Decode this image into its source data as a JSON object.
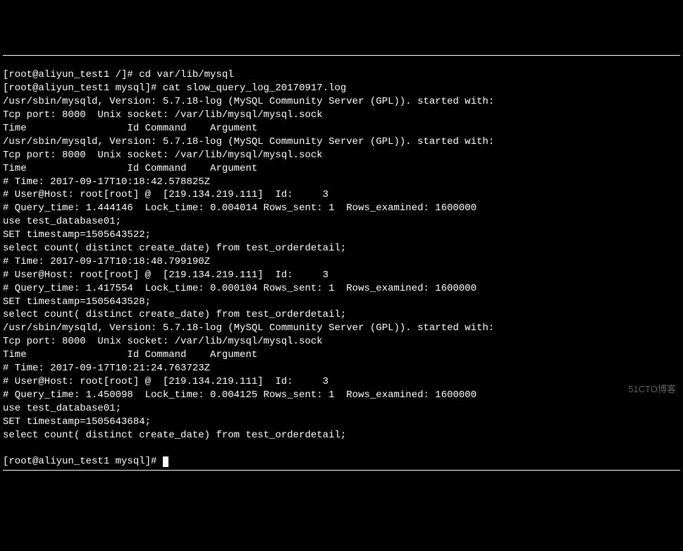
{
  "terminal": {
    "lines": [
      "[root@aliyun_test1 /]# cd var/lib/mysql",
      "[root@aliyun_test1 mysql]# cat slow_query_log_20170917.log",
      "/usr/sbin/mysqld, Version: 5.7.18-log (MySQL Community Server (GPL)). started with:",
      "Tcp port: 8000  Unix socket: /var/lib/mysql/mysql.sock",
      "Time                 Id Command    Argument",
      "/usr/sbin/mysqld, Version: 5.7.18-log (MySQL Community Server (GPL)). started with:",
      "Tcp port: 8000  Unix socket: /var/lib/mysql/mysql.sock",
      "Time                 Id Command    Argument",
      "# Time: 2017-09-17T10:18:42.578825Z",
      "# User@Host: root[root] @  [219.134.219.111]  Id:     3",
      "# Query_time: 1.444146  Lock_time: 0.004014 Rows_sent: 1  Rows_examined: 1600000",
      "use test_database01;",
      "SET timestamp=1505643522;",
      "select count( distinct create_date) from test_orderdetail;",
      "# Time: 2017-09-17T10:18:48.799190Z",
      "# User@Host: root[root] @  [219.134.219.111]  Id:     3",
      "# Query_time: 1.417554  Lock_time: 0.000104 Rows_sent: 1  Rows_examined: 1600000",
      "SET timestamp=1505643528;",
      "select count( distinct create_date) from test_orderdetail;",
      "/usr/sbin/mysqld, Version: 5.7.18-log (MySQL Community Server (GPL)). started with:",
      "Tcp port: 8000  Unix socket: /var/lib/mysql/mysql.sock",
      "Time                 Id Command    Argument",
      "# Time: 2017-09-17T10:21:24.763723Z",
      "# User@Host: root[root] @  [219.134.219.111]  Id:     3",
      "# Query_time: 1.450098  Lock_time: 0.004125 Rows_sent: 1  Rows_examined: 1600000",
      "use test_database01;",
      "SET timestamp=1505643684;",
      "select count( distinct create_date) from test_orderdetail;"
    ],
    "prompt_final": "[root@aliyun_test1 mysql]# ",
    "watermark": "51CTO博客"
  }
}
